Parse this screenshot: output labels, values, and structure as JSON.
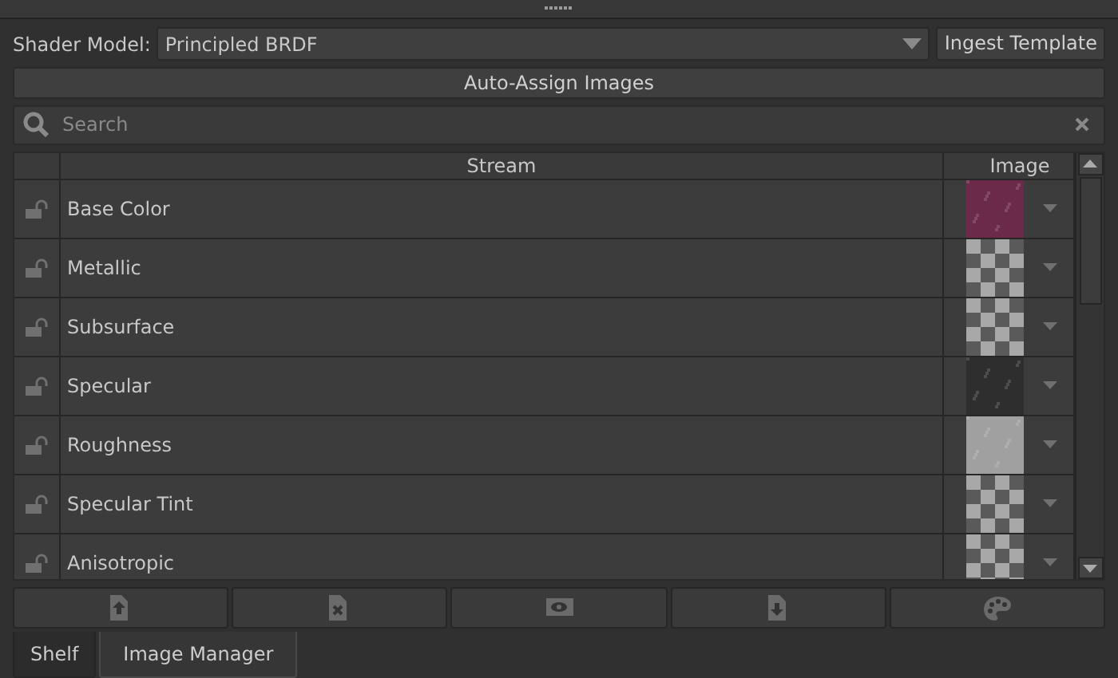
{
  "shader_model": {
    "label": "Shader Model:",
    "value": "Principled BRDF"
  },
  "ingest_button": "Ingest Template",
  "auto_assign_button": "Auto-Assign Images",
  "search": {
    "placeholder": "Search"
  },
  "table": {
    "columns": [
      "Stream",
      "Image"
    ],
    "rows": [
      {
        "name": "Base Color",
        "locked": false,
        "thumbnail": {
          "kind": "texture",
          "color": "#6b2a4a"
        }
      },
      {
        "name": "Metallic",
        "locked": false,
        "thumbnail": {
          "kind": "checker"
        }
      },
      {
        "name": "Subsurface",
        "locked": false,
        "thumbnail": {
          "kind": "checker"
        }
      },
      {
        "name": "Specular",
        "locked": false,
        "thumbnail": {
          "kind": "texture",
          "color": "#2e2e2e"
        }
      },
      {
        "name": "Roughness",
        "locked": false,
        "thumbnail": {
          "kind": "texture",
          "color": "#a0a0a0"
        }
      },
      {
        "name": "Specular Tint",
        "locked": false,
        "thumbnail": {
          "kind": "checker"
        }
      },
      {
        "name": "Anisotropic",
        "locked": false,
        "thumbnail": {
          "kind": "checker"
        }
      }
    ]
  },
  "toolbar": [
    {
      "kind": "upload"
    },
    {
      "kind": "remove"
    },
    {
      "kind": "view"
    },
    {
      "kind": "download"
    },
    {
      "kind": "palette"
    }
  ],
  "tabs": [
    {
      "label": "Shelf",
      "selected": false
    },
    {
      "label": "Image Manager",
      "selected": true
    }
  ]
}
